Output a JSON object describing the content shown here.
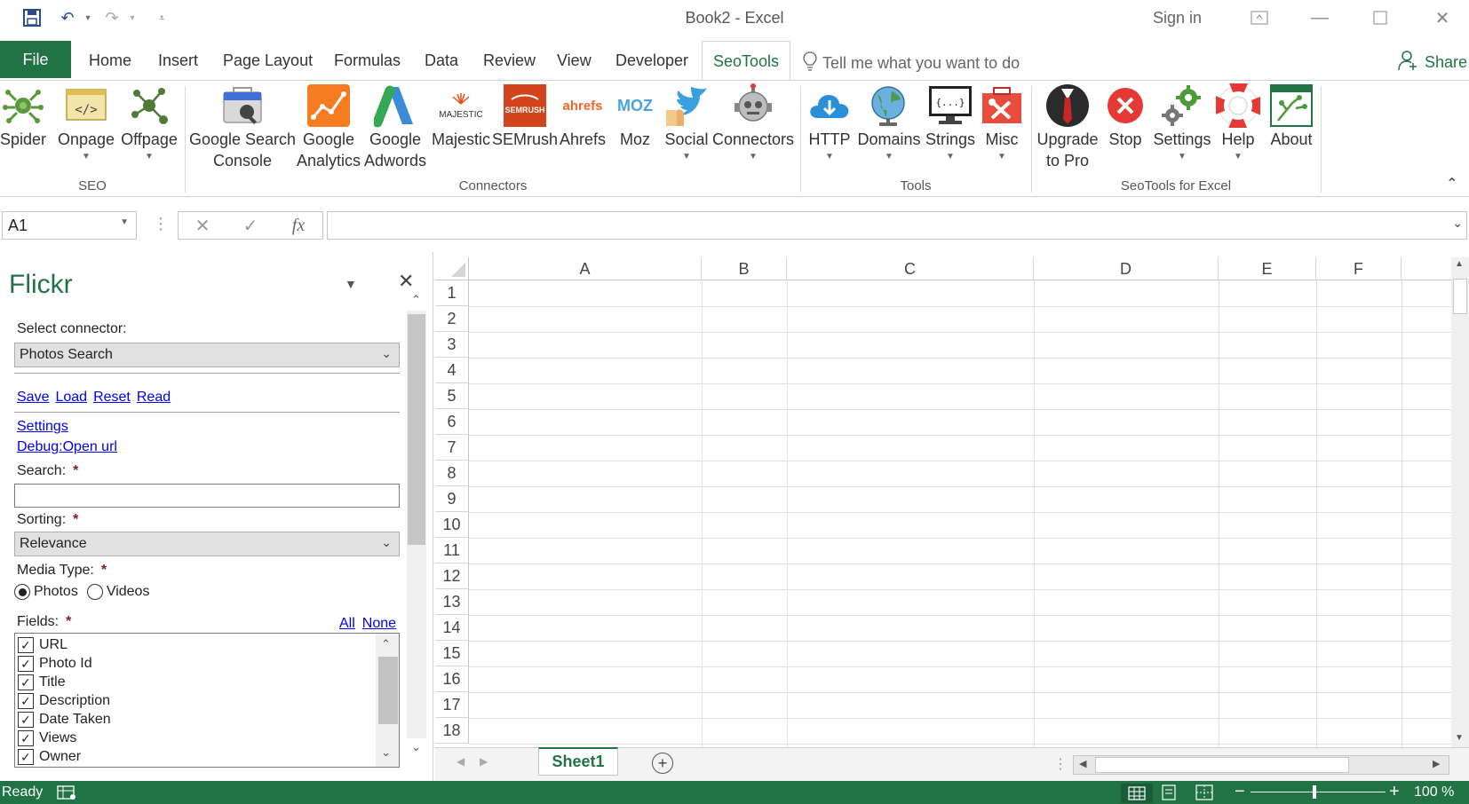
{
  "window": {
    "title": "Book2  -  Excel",
    "sign_in": "Sign in"
  },
  "tabs": [
    {
      "label": "File"
    },
    {
      "label": "Home"
    },
    {
      "label": "Insert"
    },
    {
      "label": "Page Layout"
    },
    {
      "label": "Formulas"
    },
    {
      "label": "Data"
    },
    {
      "label": "Review"
    },
    {
      "label": "View"
    },
    {
      "label": "Developer"
    },
    {
      "label": "SeoTools"
    }
  ],
  "tell_me": "Tell me what you want to do",
  "share": "Share",
  "ribbon": {
    "buttons": [
      {
        "label": "Spider",
        "icon": "spider-icon"
      },
      {
        "label": "Onpage",
        "icon": "code-icon"
      },
      {
        "label": "Offpage",
        "icon": "network-icon"
      },
      {
        "label": "Google Search\nConsole",
        "icon": "toolbox-icon"
      },
      {
        "label": "Google\nAnalytics",
        "icon": "analytics-icon"
      },
      {
        "label": "Google\nAdwords",
        "icon": "adwords-icon"
      },
      {
        "label": "Majestic",
        "icon": "majestic-icon",
        "logo_text": "MAJESTIC"
      },
      {
        "label": "SEMrush",
        "icon": "semrush-icon",
        "logo_text": "SEMRUSH"
      },
      {
        "label": "Ahrefs",
        "icon": "ahrefs-icon",
        "logo_text": "ahrefs"
      },
      {
        "label": "Moz",
        "icon": "moz-icon",
        "logo_text": "MOZ"
      },
      {
        "label": "Social",
        "icon": "social-icon"
      },
      {
        "label": "Connectors",
        "icon": "robot-icon"
      },
      {
        "label": "HTTP",
        "icon": "cloud-download-icon"
      },
      {
        "label": "Domains",
        "icon": "globe-icon"
      },
      {
        "label": "Strings",
        "icon": "monitor-code-icon",
        "logo_text": "{...}"
      },
      {
        "label": "Misc",
        "icon": "misc-toolbox-icon"
      },
      {
        "label": "Upgrade\nto Pro",
        "icon": "suit-icon"
      },
      {
        "label": "Stop",
        "icon": "stop-icon"
      },
      {
        "label": "Settings",
        "icon": "gears-icon"
      },
      {
        "label": "Help",
        "icon": "lifebuoy-icon"
      },
      {
        "label": "About",
        "icon": "about-sheet-icon"
      }
    ],
    "groups": [
      {
        "label": "SEO"
      },
      {
        "label": "Connectors"
      },
      {
        "label": "Tools"
      },
      {
        "label": "SeoTools for Excel"
      }
    ]
  },
  "formula_bar": {
    "name_box": "A1",
    "formula": ""
  },
  "pane": {
    "title": "Flickr",
    "select_connector_label": "Select connector:",
    "connector_value": "Photos Search",
    "links": {
      "save": "Save",
      "load": "Load",
      "reset": "Reset",
      "read": "Read"
    },
    "settings_link": "Settings",
    "debug_link": "Debug:Open url",
    "search_label": "Search:",
    "search_value": "",
    "sorting_label": "Sorting:",
    "sorting_value": "Relevance",
    "media_type_label": "Media Type:",
    "media_options": [
      "Photos",
      "Videos"
    ],
    "media_selected": "Photos",
    "fields_label": "Fields:",
    "fields_all": "All",
    "fields_none": "None",
    "fields": [
      {
        "label": "URL",
        "checked": true
      },
      {
        "label": "Photo Id",
        "checked": true
      },
      {
        "label": "Title",
        "checked": true
      },
      {
        "label": "Description",
        "checked": true
      },
      {
        "label": "Date Taken",
        "checked": true
      },
      {
        "label": "Views",
        "checked": true
      },
      {
        "label": "Owner",
        "checked": true
      }
    ],
    "required_mark": "*"
  },
  "grid": {
    "columns": [
      "A",
      "B",
      "C",
      "D",
      "E",
      "F"
    ],
    "rows": [
      "1",
      "2",
      "3",
      "4",
      "5",
      "6",
      "7",
      "8",
      "9",
      "10",
      "11",
      "12",
      "13",
      "14",
      "15",
      "16",
      "17",
      "18"
    ]
  },
  "sheets": [
    {
      "label": "Sheet1",
      "active": true
    }
  ],
  "status": {
    "ready": "Ready",
    "zoom": "100 %"
  },
  "colors": {
    "excel_green": "#217346",
    "link_blue": "#0000ee",
    "required_red": "#8b1a1a"
  }
}
